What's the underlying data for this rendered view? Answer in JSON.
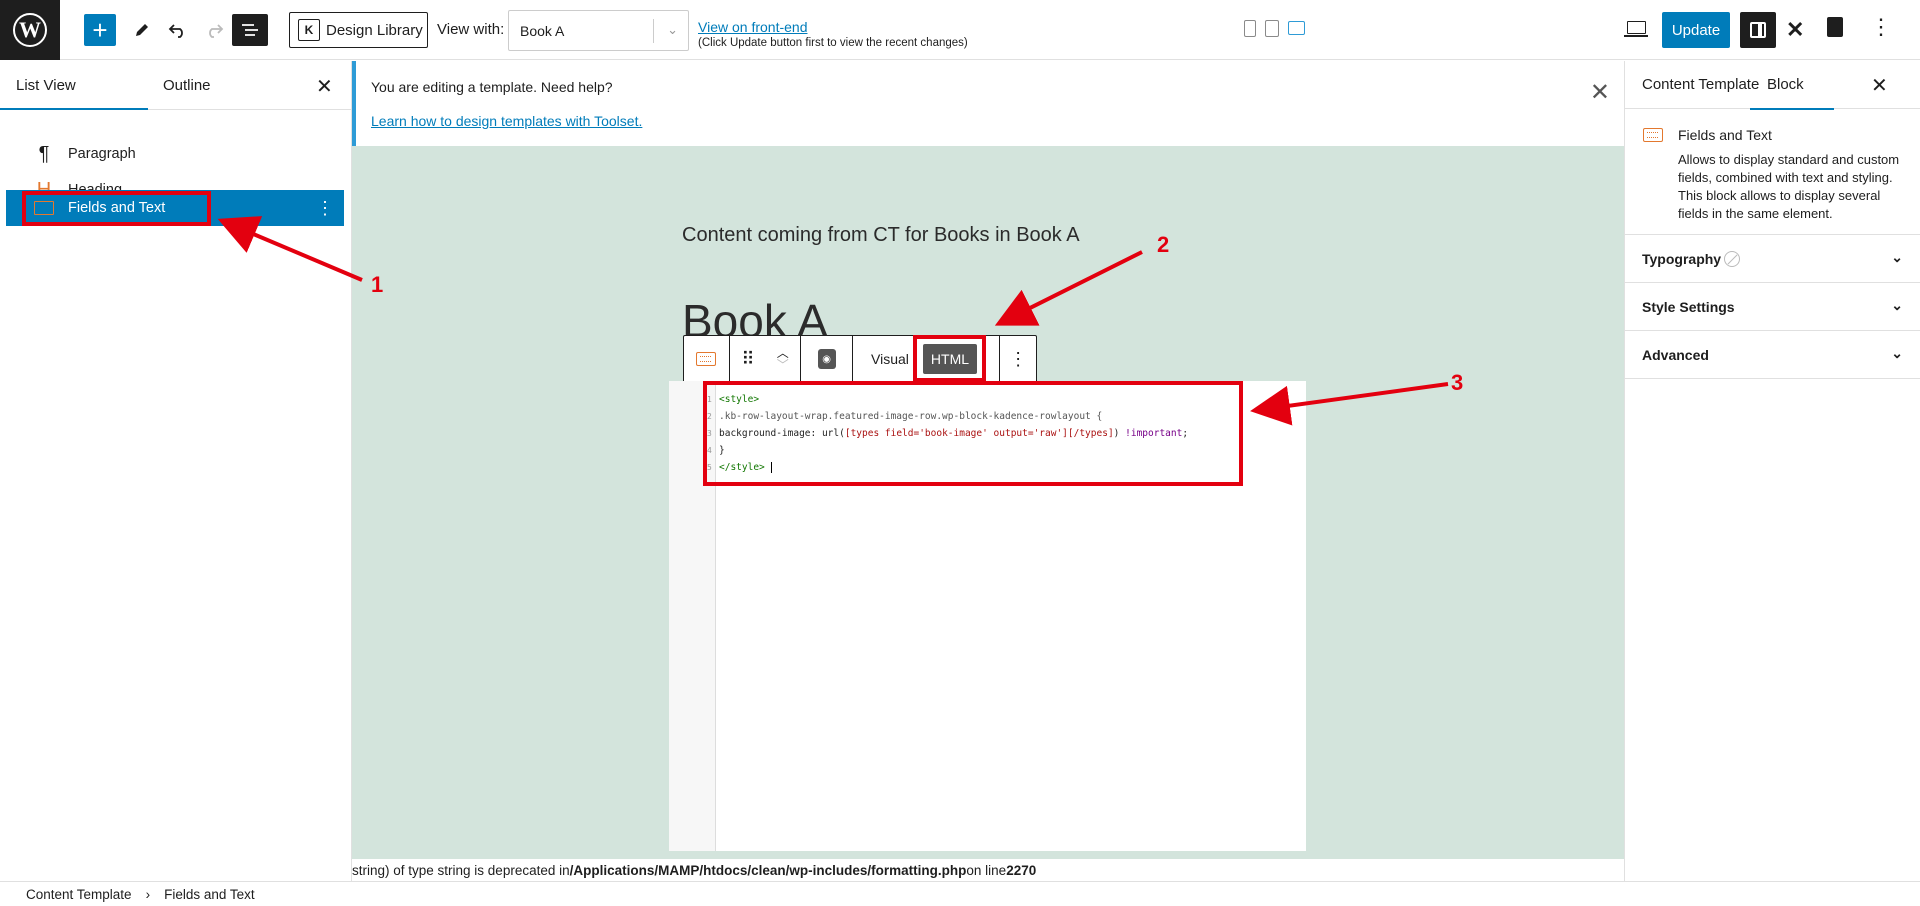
{
  "toolbar": {
    "add_icon": "+",
    "design_library_label": "Design Library",
    "view_with_label": "View with:",
    "view_with_value": "Book A",
    "view_frontend_link": "View on front-end",
    "view_frontend_note": "(Click Update button first to view the recent changes)",
    "update_label": "Update",
    "more_icon": "⋮",
    "accent_color": "#007cba"
  },
  "left_panel": {
    "tabs": [
      "List View",
      "Outline"
    ],
    "close_icon": "✕",
    "items": [
      {
        "icon": "paragraph-icon",
        "glyph": "¶",
        "label": "Paragraph"
      },
      {
        "icon": "heading-icon",
        "glyph": "H",
        "label": "Heading"
      },
      {
        "icon": "fields-and-text-icon",
        "glyph": "",
        "label": "Fields and Text"
      }
    ]
  },
  "notice": {
    "text": "You are editing a template. Need help?",
    "link": "Learn how to design templates with Toolset.",
    "close_icon": "✕"
  },
  "canvas": {
    "content_text": "Content coming from CT for Books in Book A",
    "book_title": "Book A",
    "mode_visual": "Visual",
    "mode_html": "HTML",
    "code_lines": [
      {
        "n": "1",
        "text": "<style>"
      },
      {
        "n": "2",
        "text": ".kb-row-layout-wrap.featured-image-row.wp-block-kadence-rowlayout {"
      },
      {
        "n": "3",
        "pre": "background-image: url(",
        "str": "[types field='book-image' output='raw'][/types]",
        "post": ") ",
        "kw": "!important",
        "end": ";"
      },
      {
        "n": "4",
        "text": "}"
      },
      {
        "n": "5",
        "text": "</style>"
      }
    ],
    "deprecation_prefix": "string) of type string is deprecated in ",
    "deprecation_path": "/Applications/MAMP/htdocs/clean/wp-includes/formatting.php",
    "deprecation_mid": " on line ",
    "deprecation_line": "2270"
  },
  "right_panel": {
    "tabs": [
      "Content Template",
      "Block"
    ],
    "close_icon": "✕",
    "block_name": "Fields and Text",
    "block_description": "Allows to display standard and custom fields, combined with text and styling. This block allows to display several fields in the same element.",
    "sections": [
      "Typography",
      "Style Settings",
      "Advanced"
    ]
  },
  "breadcrumb": [
    "Content Template",
    "Fields and Text"
  ],
  "annotations": [
    "1",
    "2",
    "3"
  ]
}
